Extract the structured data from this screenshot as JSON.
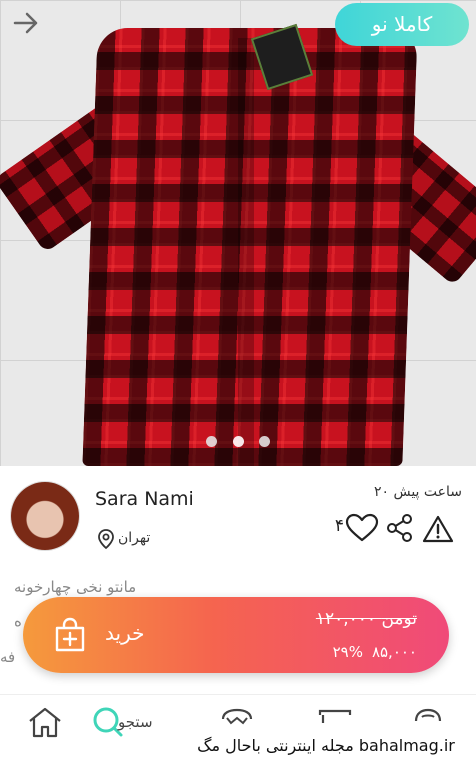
{
  "header": {
    "back_icon": "arrow-right-icon",
    "condition_badge": "کاملا نو"
  },
  "gallery": {
    "slides_total": 3,
    "active_slide": 2
  },
  "seller": {
    "name": "Sara Nami",
    "location": "تهران",
    "posted": "۲۰ ساعت پیش",
    "likes": "۴"
  },
  "description": {
    "line1": "مانتو نخی چهارخونه",
    "line2": "ه",
    "line3": "فه"
  },
  "purchase": {
    "buy_label": "خرید",
    "old_price": "۱۲۰,۰۰۰ تومن",
    "discount": "۲۹%",
    "new_price": "۸۵,۰۰۰"
  },
  "nav": {
    "search_label": "ستجو"
  },
  "watermark": "مجله اینترنتی باحال مگ bahalmag.ir",
  "colors": {
    "badge": "#3fd5d8",
    "buy_gradient_start": "#f59a3c",
    "buy_gradient_end": "#f04a79",
    "search_accent": "#3fd5b8"
  }
}
